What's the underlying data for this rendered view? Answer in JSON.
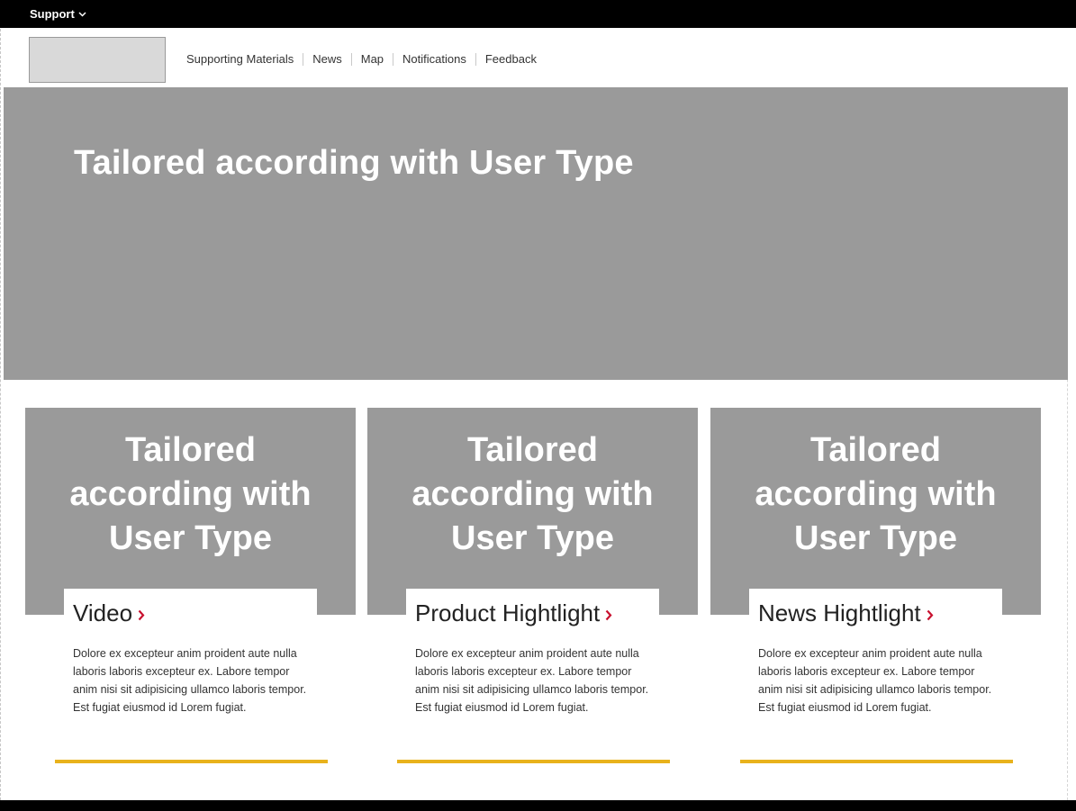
{
  "topbar": {
    "support_label": "Support"
  },
  "header": {
    "nav": [
      {
        "label": "Supporting Materials"
      },
      {
        "label": "News"
      },
      {
        "label": "Map"
      },
      {
        "label": "Notifications"
      },
      {
        "label": "Feedback"
      }
    ]
  },
  "hero": {
    "title": "Tailored according with User Type"
  },
  "cards": [
    {
      "media_text": "Tailored according with User Type",
      "title": "Video",
      "text": "Dolore ex excepteur anim proident aute nulla laboris laboris excepteur ex. Labore tempor anim nisi sit adipisicing ullamco laboris tempor. Est fugiat eiusmod id Lorem fugiat."
    },
    {
      "media_text": "Tailored according with User Type",
      "title": "Product Hightlight",
      "text": "Dolore ex excepteur anim proident aute nulla laboris laboris excepteur ex. Labore tempor anim nisi sit adipisicing ullamco laboris tempor. Est fugiat eiusmod id Lorem fugiat."
    },
    {
      "media_text": "Tailored according with User Type",
      "title": "News Hightlight",
      "text": "Dolore ex excepteur anim proident aute nulla laboris laboris excepteur ex. Labore tempor anim nisi sit adipisicing ullamco laboris tempor. Est fugiat eiusmod id Lorem fugiat."
    }
  ],
  "icons": {
    "support_dropdown": "chevron-down-icon",
    "card_link": "chevron-right-icon"
  },
  "colors": {
    "topbar": "#000000",
    "placeholder_gray": "#9a9a9a",
    "logo_placeholder": "#d9d9d9",
    "accent_rule": "#e8b21c",
    "link_chevron": "#c8102e"
  }
}
